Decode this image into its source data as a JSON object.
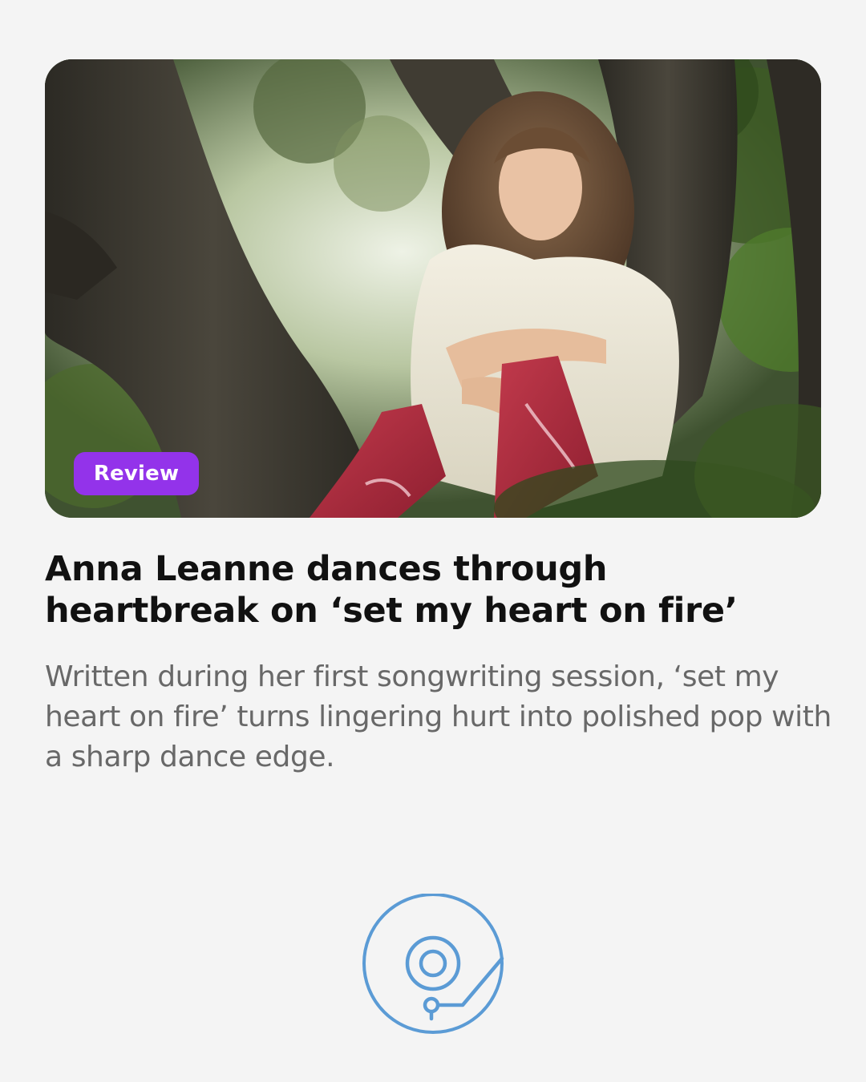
{
  "article": {
    "badge_label": "Review",
    "title": "Anna Leanne dances through heartbreak on ‘set my heart on fire’",
    "summary": "Written during her first songwriting session, ‘set my heart on fire’ turns lingering hurt into polished pop with a sharp dance edge."
  },
  "colors": {
    "background": "#f4f4f4",
    "badge": "#9333ea",
    "title": "#111111",
    "summary": "#686868",
    "logo": "#5b9bd5"
  },
  "icons": {
    "logo": "vinyl-record-turntable-icon"
  }
}
